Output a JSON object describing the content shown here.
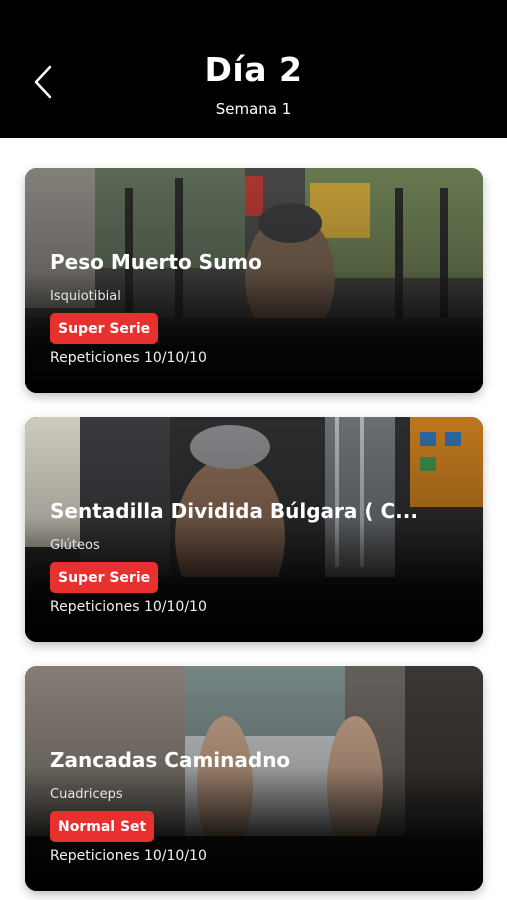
{
  "header": {
    "title": "Día 2",
    "subtitle": "Semana 1",
    "back_icon": "chevron-left-icon"
  },
  "colors": {
    "header_bg": "#000000",
    "badge": "#e8302f",
    "page_bg": "#ffffff"
  },
  "exercises": [
    {
      "name": "Peso Muerto Sumo",
      "muscle": "Isquiotibial",
      "badge": "Super Serie",
      "reps": "Repeticiones 10/10/10"
    },
    {
      "name": "Sentadilla Dividida Búlgara ( C...",
      "muscle": "Glúteos",
      "badge": "Super Serie",
      "reps": "Repeticiones 10/10/10"
    },
    {
      "name": "Zancadas Caminadno",
      "muscle": "Cuadriceps",
      "badge": "Normal Set",
      "reps": "Repeticiones 10/10/10"
    }
  ]
}
